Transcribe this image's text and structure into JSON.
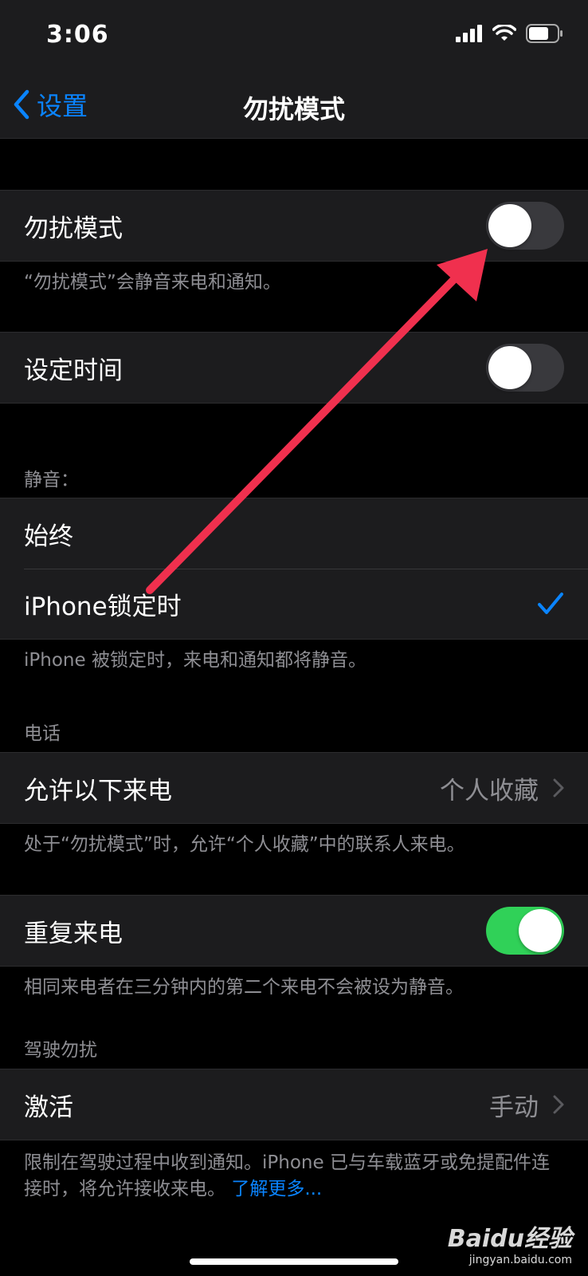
{
  "status_bar": {
    "time": "3:06"
  },
  "nav": {
    "back_label": "设置",
    "title": "勿扰模式"
  },
  "dnd": {
    "label": "勿扰模式",
    "footer": "“勿扰模式”会静音来电和通知。"
  },
  "scheduled": {
    "label": "设定时间"
  },
  "silence": {
    "header": "静音：",
    "always_label": "始终",
    "locked_label": "iPhone锁定时",
    "footer": "iPhone 被锁定时，来电和通知都将静音。"
  },
  "phone": {
    "header": "电话",
    "allow_calls_label": "允许以下来电",
    "allow_calls_value": "个人收藏",
    "allow_calls_footer": "处于“勿扰模式”时，允许“个人收藏”中的联系人来电。",
    "repeated_calls_label": "重复来电",
    "repeated_calls_footer": "相同来电者在三分钟内的第二个来电不会被设为静音。"
  },
  "driving": {
    "header": "驾驶勿扰",
    "activate_label": "激活",
    "activate_value": "手动",
    "footer": "限制在驾驶过程中收到通知。iPhone 已与车载蓝牙或免提配件连接时，将允许接收来电。",
    "learn_more": "了解更多..."
  },
  "watermark": {
    "logo": "Baidu经验",
    "url": "jingyan.baidu.com"
  },
  "toggles": {
    "dnd_on": false,
    "scheduled_on": false,
    "repeated_calls_on": true
  },
  "colors": {
    "accent": "#0a84ff",
    "toggle_on": "#30d158",
    "annotation_arrow": "#f0304e"
  },
  "icons": [
    "signal-icon",
    "wifi-icon",
    "battery-icon",
    "back-chevron-icon",
    "checkmark-icon",
    "chevron-right-icon"
  ]
}
